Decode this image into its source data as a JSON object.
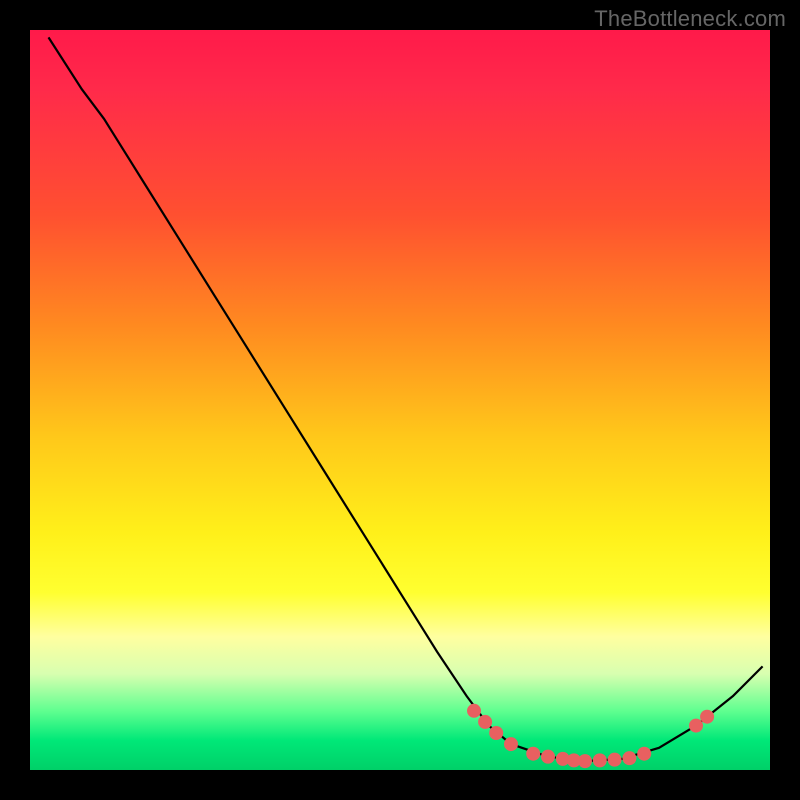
{
  "watermark": "TheBottleneck.com",
  "chart_data": {
    "type": "line",
    "title": "",
    "xlabel": "",
    "ylabel": "",
    "xlim": [
      0,
      100
    ],
    "ylim": [
      0,
      100
    ],
    "curve": {
      "name": "bottleneck-curve",
      "points": [
        {
          "x": 2.5,
          "y": 99
        },
        {
          "x": 7,
          "y": 92
        },
        {
          "x": 10,
          "y": 88
        },
        {
          "x": 15,
          "y": 80
        },
        {
          "x": 20,
          "y": 72
        },
        {
          "x": 25,
          "y": 64
        },
        {
          "x": 30,
          "y": 56
        },
        {
          "x": 35,
          "y": 48
        },
        {
          "x": 40,
          "y": 40
        },
        {
          "x": 45,
          "y": 32
        },
        {
          "x": 50,
          "y": 24
        },
        {
          "x": 55,
          "y": 16
        },
        {
          "x": 59,
          "y": 10
        },
        {
          "x": 62,
          "y": 6
        },
        {
          "x": 65,
          "y": 3.5
        },
        {
          "x": 70,
          "y": 1.8
        },
        {
          "x": 75,
          "y": 1.2
        },
        {
          "x": 80,
          "y": 1.5
        },
        {
          "x": 85,
          "y": 3
        },
        {
          "x": 90,
          "y": 6
        },
        {
          "x": 95,
          "y": 10
        },
        {
          "x": 99,
          "y": 14
        }
      ]
    },
    "markers": {
      "name": "highlight-points",
      "color": "#e86060",
      "points": [
        {
          "x": 60,
          "y": 8
        },
        {
          "x": 61.5,
          "y": 6.5
        },
        {
          "x": 63,
          "y": 5
        },
        {
          "x": 65,
          "y": 3.5
        },
        {
          "x": 68,
          "y": 2.2
        },
        {
          "x": 70,
          "y": 1.8
        },
        {
          "x": 72,
          "y": 1.5
        },
        {
          "x": 73.5,
          "y": 1.3
        },
        {
          "x": 75,
          "y": 1.2
        },
        {
          "x": 77,
          "y": 1.3
        },
        {
          "x": 79,
          "y": 1.4
        },
        {
          "x": 81,
          "y": 1.6
        },
        {
          "x": 83,
          "y": 2.2
        },
        {
          "x": 90,
          "y": 6
        },
        {
          "x": 91.5,
          "y": 7.2
        }
      ]
    }
  }
}
